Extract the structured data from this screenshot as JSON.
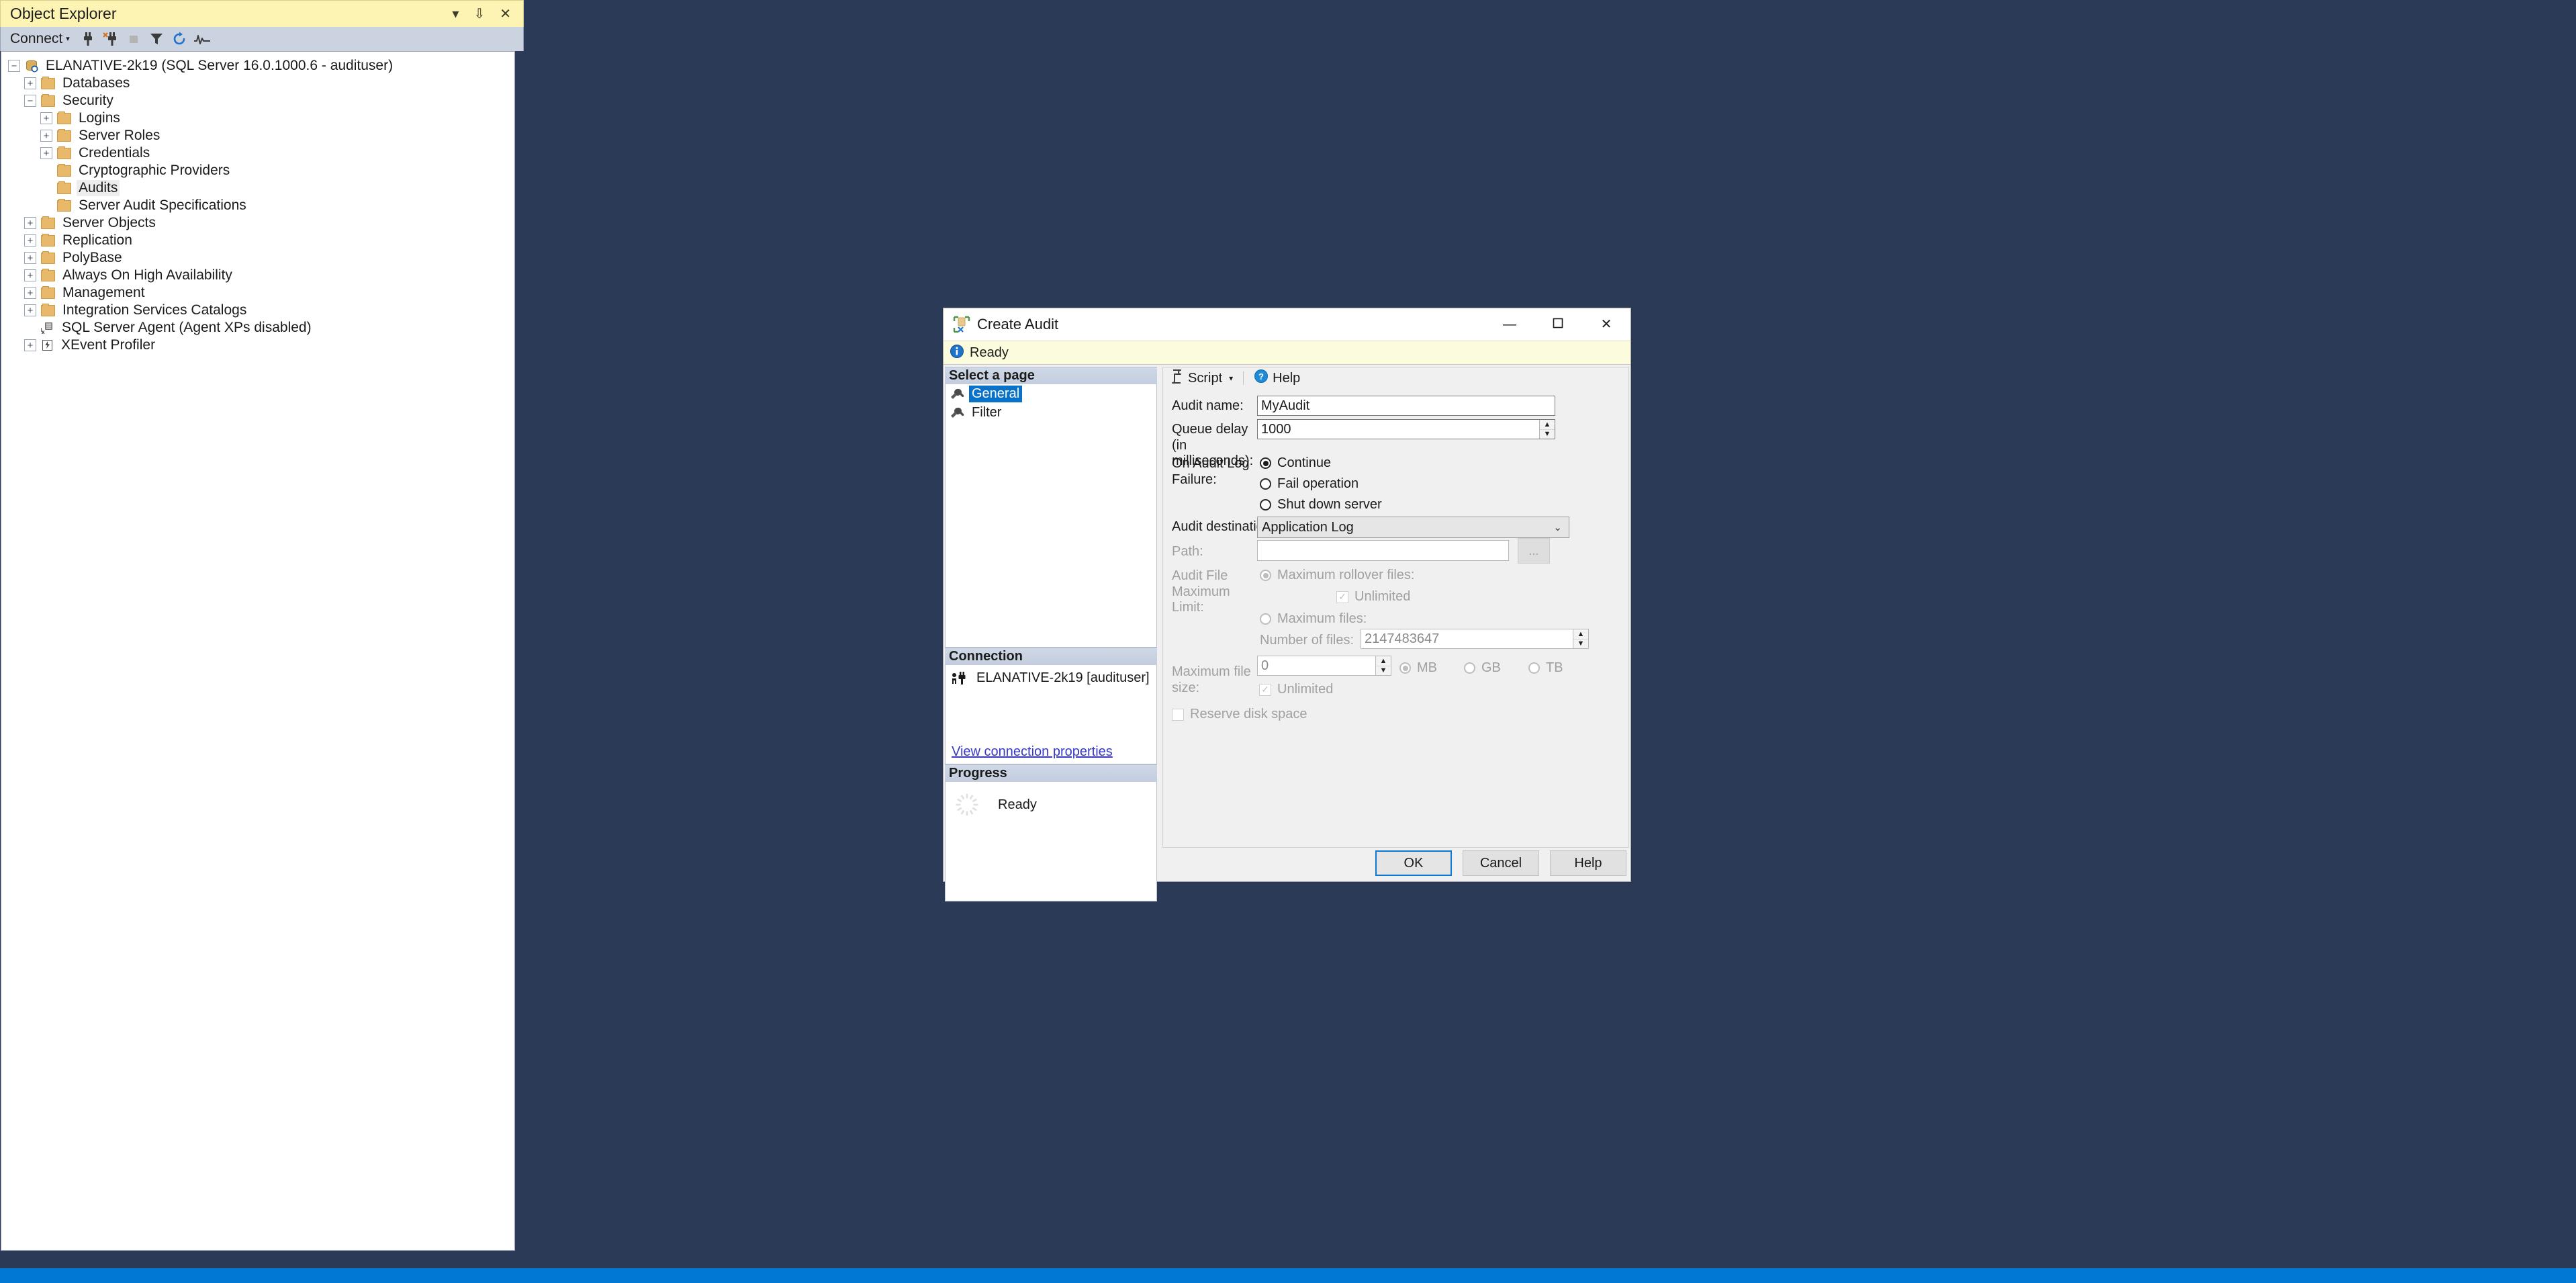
{
  "object_explorer": {
    "title": "Object Explorer",
    "title_buttons": [
      {
        "name": "dropdown-icon",
        "glyph": "▾"
      },
      {
        "name": "pin-icon",
        "glyph": "⇩"
      },
      {
        "name": "close-icon",
        "glyph": "✕"
      }
    ],
    "toolbar": {
      "connect_label": "Connect",
      "caret": "▾",
      "icons": [
        "connect-object-explorer-icon",
        "disconnect-icon",
        "stop-icon",
        "filter-icon",
        "refresh-icon",
        "activity-monitor-icon"
      ]
    },
    "tree": [
      {
        "label": "ELANATIVE-2k19 (SQL Server 16.0.1000.6 - audituser)",
        "indent": 0,
        "expander": "minus",
        "icon": "server-icon",
        "selected": false
      },
      {
        "label": "Databases",
        "indent": 1,
        "expander": "plus",
        "icon": "folder",
        "selected": false
      },
      {
        "label": "Security",
        "indent": 1,
        "expander": "minus",
        "icon": "folder",
        "selected": false
      },
      {
        "label": "Logins",
        "indent": 2,
        "expander": "plus",
        "icon": "folder",
        "selected": false
      },
      {
        "label": "Server Roles",
        "indent": 2,
        "expander": "plus",
        "icon": "folder",
        "selected": false
      },
      {
        "label": "Credentials",
        "indent": 2,
        "expander": "plus",
        "icon": "folder",
        "selected": false
      },
      {
        "label": "Cryptographic Providers",
        "indent": 2,
        "expander": "none",
        "icon": "folder",
        "selected": false
      },
      {
        "label": "Audits",
        "indent": 2,
        "expander": "none",
        "icon": "folder",
        "selected": true
      },
      {
        "label": "Server Audit Specifications",
        "indent": 2,
        "expander": "none",
        "icon": "folder",
        "selected": false
      },
      {
        "label": "Server Objects",
        "indent": 1,
        "expander": "plus",
        "icon": "folder",
        "selected": false
      },
      {
        "label": "Replication",
        "indent": 1,
        "expander": "plus",
        "icon": "folder",
        "selected": false
      },
      {
        "label": "PolyBase",
        "indent": 1,
        "expander": "plus",
        "icon": "folder",
        "selected": false
      },
      {
        "label": "Always On High Availability",
        "indent": 1,
        "expander": "plus",
        "icon": "folder",
        "selected": false
      },
      {
        "label": "Management",
        "indent": 1,
        "expander": "plus",
        "icon": "folder",
        "selected": false
      },
      {
        "label": "Integration Services Catalogs",
        "indent": 1,
        "expander": "plus",
        "icon": "folder",
        "selected": false
      },
      {
        "label": "SQL Server Agent (Agent XPs disabled)",
        "indent": 1,
        "expander": "none",
        "icon": "agent-icon",
        "selected": false
      },
      {
        "label": "XEvent Profiler",
        "indent": 1,
        "expander": "plus",
        "icon": "xevent-icon",
        "selected": false
      }
    ]
  },
  "dialog": {
    "title": "Create Audit",
    "title_icon": "create-audit-icon",
    "window_buttons": {
      "minimize": "—",
      "maximize": "❐",
      "close": "✕"
    },
    "status": {
      "icon": "info-icon",
      "text": "Ready"
    },
    "left": {
      "pages_header": "Select a page",
      "pages": [
        {
          "label": "General",
          "selected": true,
          "icon": "wrench-icon"
        },
        {
          "label": "Filter",
          "selected": false,
          "icon": "wrench-icon"
        }
      ],
      "connection_header": "Connection",
      "connection_server": "ELANATIVE-2k19 [audituser]",
      "connection_icon": "connection-icon",
      "connection_link": "View connection properties",
      "progress_header": "Progress",
      "progress_text": "Ready",
      "progress_icon": "spinner-icon"
    },
    "toolbar": {
      "script_label": "Script",
      "script_caret": "▾",
      "script_icon": "script-icon",
      "help_label": "Help",
      "help_icon": "help-icon"
    },
    "form": {
      "audit_name_label": "Audit name:",
      "audit_name_value": "MyAudit",
      "queue_delay_label": "Queue delay (in milliseconds):",
      "queue_delay_value": "1000",
      "on_failure_label": "On Audit Log Failure:",
      "on_failure_options": [
        {
          "label": "Continue",
          "checked": true
        },
        {
          "label": "Fail operation",
          "checked": false
        },
        {
          "label": "Shut down server",
          "checked": false
        }
      ],
      "audit_destination_label": "Audit destination:",
      "audit_destination_value": "Application Log",
      "path_label": "Path:",
      "path_value": "",
      "browse_button": "...",
      "audit_file_limit_label": "Audit File Maximum Limit:",
      "max_rollover_label": "Maximum rollover files:",
      "max_rollover_checked": true,
      "rollover_unlimited_label": "Unlimited",
      "rollover_unlimited_checked": true,
      "max_files_label": "Maximum files:",
      "max_files_checked": false,
      "number_of_files_label": "Number of files:",
      "number_of_files_value": "2147483647",
      "max_file_size_label": "Maximum file size:",
      "max_file_size_value": "0",
      "size_units": [
        {
          "label": "MB",
          "checked": true
        },
        {
          "label": "GB",
          "checked": false
        },
        {
          "label": "TB",
          "checked": false
        }
      ],
      "size_unlimited_label": "Unlimited",
      "size_unlimited_checked": true,
      "reserve_disk_label": "Reserve disk space",
      "reserve_disk_checked": false
    },
    "buttons": {
      "ok": "OK",
      "cancel": "Cancel",
      "help": "Help"
    }
  },
  "colors": {
    "desktop": "#2b3a57",
    "panel_title": "#fdf3b3",
    "status_bar": "#0078d4",
    "selection": "#0a71c8",
    "link": "#3737c8"
  }
}
